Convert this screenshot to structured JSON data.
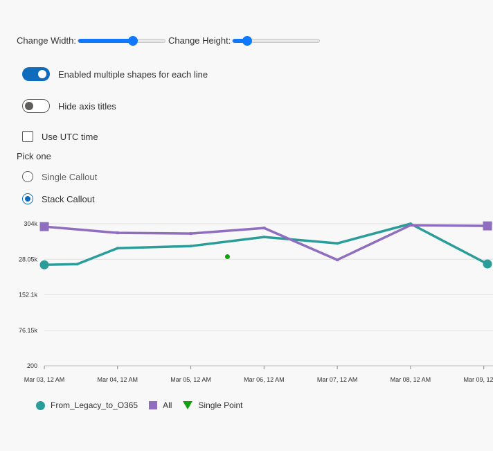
{
  "controls": {
    "width_label": "Change Width:",
    "height_label": "Change Height:",
    "width_value": 0.62,
    "height_value": 0.16,
    "multiple_shapes_label": "Enabled multiple shapes for each line",
    "multiple_shapes_on": true,
    "hide_axis_titles_label": "Hide axis titles",
    "hide_axis_titles_on": false,
    "utc_label": "Use UTC time",
    "utc_checked": false,
    "pick_label": "Pick one",
    "callout_options": [
      {
        "label": "Single Callout",
        "checked": false
      },
      {
        "label": "Stack Callout",
        "checked": true
      }
    ]
  },
  "colors": {
    "series1": "#2a9d9b",
    "series2": "#8f6dbf",
    "series3": "#13a10e",
    "accent": "#0f6cbd"
  },
  "chart_data": {
    "type": "line",
    "y_ticks": [
      "304k",
      "28.05k",
      "152.1k",
      "76.15k",
      "200"
    ],
    "x_ticks": [
      "Mar 03, 12 AM",
      "Mar 04, 12 AM",
      "Mar 05, 12 AM",
      "Mar 06, 12 AM",
      "Mar 07, 12 AM",
      "Mar 08, 12 AM",
      "Mar 09, 12 AM"
    ],
    "x_range_days": [
      0,
      6.05
    ],
    "series": [
      {
        "name": "From_Legacy_to_O365",
        "shape": "circle",
        "points": [
          [
            0,
            0.711
          ],
          [
            0.45,
            0.716
          ],
          [
            1.0,
            0.828
          ],
          [
            2.0,
            0.843
          ],
          [
            3.0,
            0.907
          ],
          [
            4.0,
            0.862
          ],
          [
            5.0,
            1.0
          ],
          [
            6.05,
            0.717
          ]
        ]
      },
      {
        "name": "All",
        "shape": "square",
        "points": [
          [
            0,
            0.98
          ],
          [
            1.0,
            0.936
          ],
          [
            2.0,
            0.931
          ],
          [
            3.0,
            0.97
          ],
          [
            4.0,
            0.746
          ],
          [
            5.0,
            0.99
          ],
          [
            6.05,
            0.985
          ]
        ]
      },
      {
        "name": "Single Point",
        "shape": "triangle",
        "points": [
          [
            2.5,
            0.768
          ]
        ]
      }
    ]
  }
}
